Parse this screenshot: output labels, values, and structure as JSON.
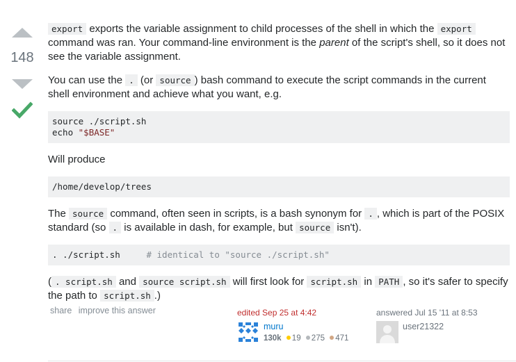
{
  "vote": {
    "count": "148"
  },
  "answer": {
    "p1": {
      "code_export": "export",
      "t1": " exports the variable assignment to child processes of the shell in which the ",
      "t2": " command was ran. Your command-line environment is the ",
      "em_parent": "parent",
      "t3": " of the script's shell, so it does not see the variable assignment."
    },
    "p2": {
      "t1": "You can use the ",
      "code_dot": ".",
      "t2": " (or ",
      "code_source": "source",
      "t3": ") bash command to execute the script commands in the current shell environment and achieve what you want, e.g."
    },
    "code1": {
      "line1": "source ./script.sh",
      "line2_cmd": "echo ",
      "line2_str": "\"$BASE\""
    },
    "p3": "Will produce",
    "code2": "/home/develop/trees",
    "p4": {
      "t1": "The ",
      "t2": " command, often seen in scripts, is a bash synonym for ",
      "t3": ", which is part of the POSIX standard (so ",
      "t4": " is available in dash, for example, but ",
      "t5": " isn't)."
    },
    "code3": {
      "cmd": ". ./script.sh",
      "comment": "# identical to \"source ./script.sh\""
    },
    "p5": {
      "t1": "(",
      "code_a": ". script.sh",
      "t2": " and ",
      "code_b": "source script.sh",
      "t3": " will first look for ",
      "code_c": "script.sh",
      "t4": " in ",
      "code_d": "PATH",
      "t5": ", so it's safer to specify the path to ",
      "code_e": "script.sh",
      "t6": ".)"
    }
  },
  "post_menu": {
    "share": "share",
    "improve": "improve this answer"
  },
  "edited": {
    "action": "edited Sep 25 at 4:42",
    "user": "muru",
    "rep": "130k",
    "gold": "19",
    "silver": "275",
    "bronze": "471"
  },
  "answered": {
    "action": "answered Jul 15 '11 at 8:53",
    "user": "user21322"
  },
  "colors": {
    "accepted": "#48a868",
    "link": "#0077cc",
    "edited": "#c02e2e",
    "code_bg": "#eff0f1"
  }
}
